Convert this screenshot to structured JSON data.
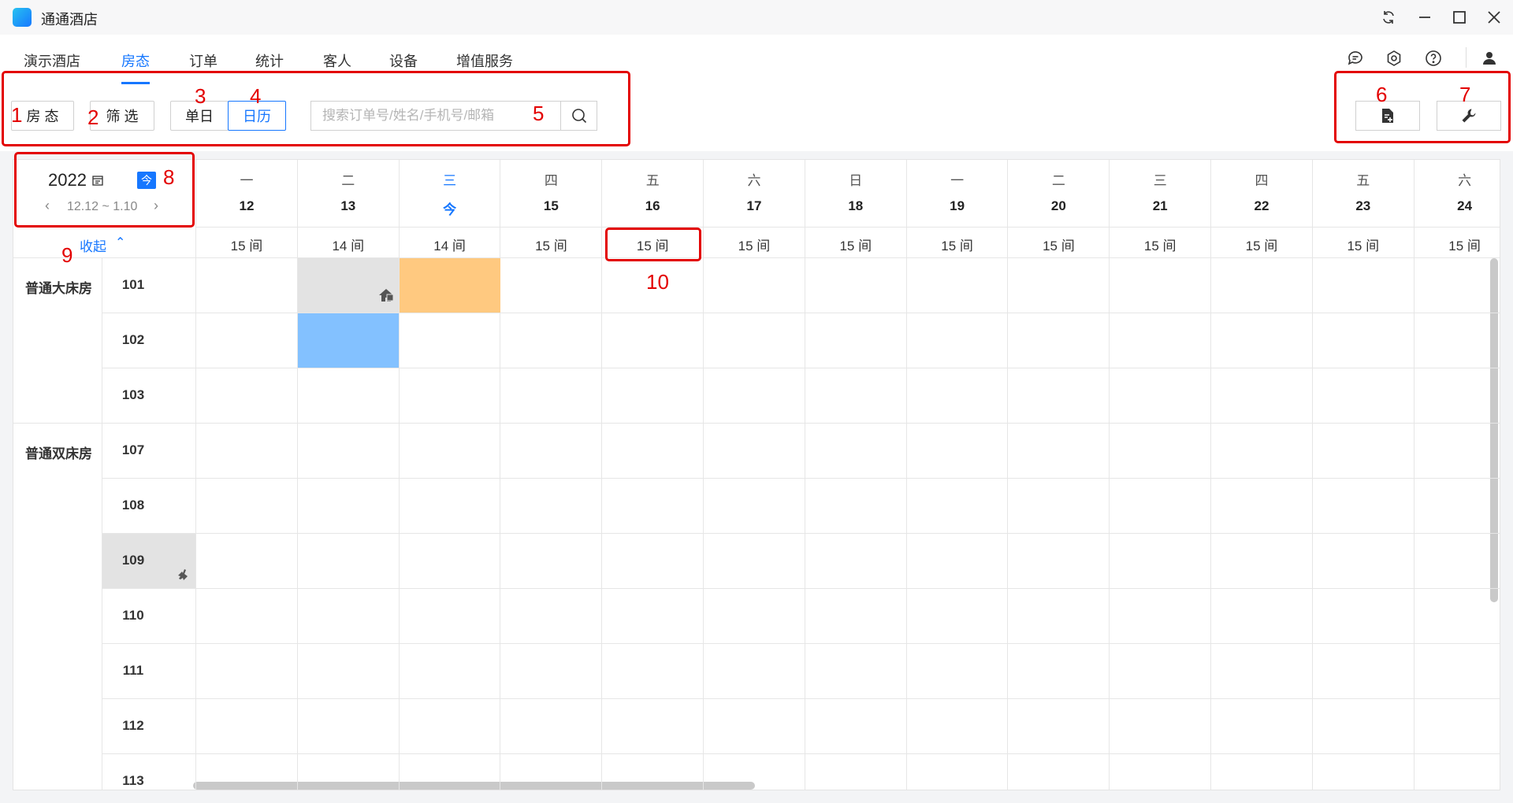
{
  "app": {
    "title": "通通酒店"
  },
  "nav": {
    "tabs": [
      {
        "label": "演示酒店"
      },
      {
        "label": "房态"
      },
      {
        "label": "订单"
      },
      {
        "label": "统计"
      },
      {
        "label": "客人"
      },
      {
        "label": "设备"
      },
      {
        "label": "增值服务"
      }
    ],
    "active": "房态"
  },
  "toolbar": {
    "room_status_label": "房 态",
    "filter_label": "筛 选",
    "single_day_label": "单日",
    "calendar_label": "日历",
    "search_placeholder": "搜索订单号/姓名/手机号/邮箱",
    "active_view": "日历"
  },
  "calendar": {
    "year": "2022",
    "today_badge": "今",
    "range": "12.12 ~ 1.10",
    "collapse_label": "收起",
    "days": [
      {
        "weekday": "一",
        "date": "12",
        "rooms": "15 间"
      },
      {
        "weekday": "二",
        "date": "13",
        "rooms": "14 间"
      },
      {
        "weekday": "三",
        "date": "今",
        "rooms": "14 间",
        "today": true
      },
      {
        "weekday": "四",
        "date": "15",
        "rooms": "15 间"
      },
      {
        "weekday": "五",
        "date": "16",
        "rooms": "15 间"
      },
      {
        "weekday": "六",
        "date": "17",
        "rooms": "15 间"
      },
      {
        "weekday": "日",
        "date": "18",
        "rooms": "15 间"
      },
      {
        "weekday": "一",
        "date": "19",
        "rooms": "15 间"
      },
      {
        "weekday": "二",
        "date": "20",
        "rooms": "15 间"
      },
      {
        "weekday": "三",
        "date": "21",
        "rooms": "15 间"
      },
      {
        "weekday": "四",
        "date": "22",
        "rooms": "15 间"
      },
      {
        "weekday": "五",
        "date": "23",
        "rooms": "15 间"
      },
      {
        "weekday": "六",
        "date": "24",
        "rooms": "15 间"
      }
    ],
    "room_types": [
      {
        "name": "普通大床房",
        "rooms": [
          "101",
          "102",
          "103"
        ]
      },
      {
        "name": "普通双床房",
        "rooms": [
          "107",
          "108",
          "109",
          "110",
          "111",
          "112",
          "113"
        ]
      }
    ],
    "blocks": [
      {
        "room": "101",
        "day": 1,
        "color": "#e3e3e3",
        "icon": "house-icon"
      },
      {
        "room": "101",
        "day": 2,
        "color": "#ffc980"
      },
      {
        "room": "102",
        "day": 1,
        "color": "#83c1ff"
      }
    ],
    "dirty_room": {
      "room": "109",
      "icon": "broom-icon"
    }
  },
  "annotations": [
    "1",
    "2",
    "3",
    "4",
    "5",
    "6",
    "7",
    "8",
    "9",
    "10"
  ],
  "colors": {
    "accent": "#1677ff",
    "annotation": "#e30000",
    "occupied_gray": "#e3e3e3",
    "booked_orange": "#ffc980",
    "checked_in_blue": "#83c1ff"
  },
  "icons": [
    "refresh-icon",
    "minimize-icon",
    "maximize-icon",
    "close-icon",
    "message-icon",
    "settings-icon",
    "help-icon",
    "user-icon",
    "search-icon",
    "document-add-icon",
    "wrench-icon",
    "calendar-icon",
    "house-icon",
    "broom-icon"
  ]
}
